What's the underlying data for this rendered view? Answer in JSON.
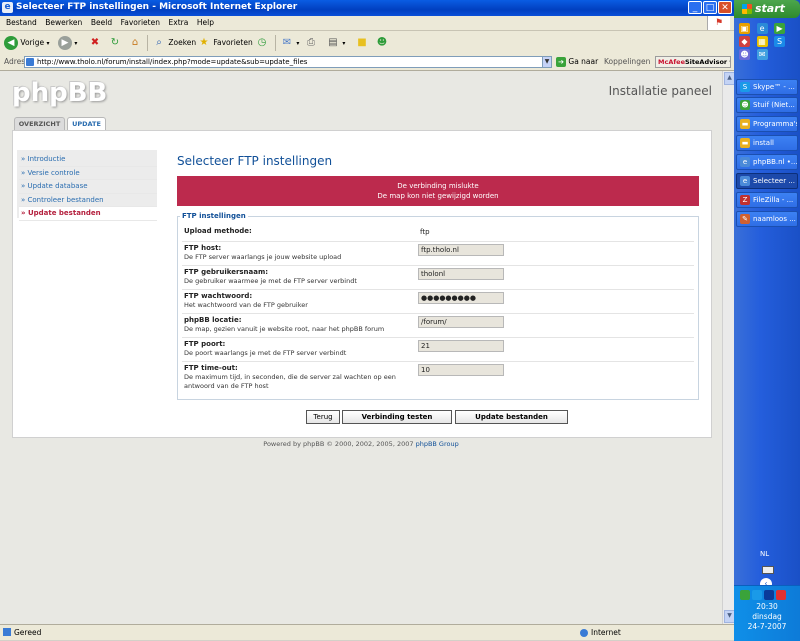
{
  "window": {
    "title": "Selecteer FTP instellingen - Microsoft Internet Explorer"
  },
  "menu": [
    "Bestand",
    "Bewerken",
    "Beeld",
    "Favorieten",
    "Extra",
    "Help"
  ],
  "toolbar": {
    "back": "Vorige",
    "search": "Zoeken",
    "favorites": "Favorieten"
  },
  "address": {
    "label": "Adres",
    "url": "http://www.tholo.nl/forum/install/index.php?mode=update&sub=update_files",
    "go": "Ga naar",
    "links": "Koppelingen",
    "mcafee_brand": "McAfee",
    "mcafee_product": "SiteAdvisor"
  },
  "page": {
    "logo": "phpBB",
    "panel_title": "Installatie paneel",
    "tabs": [
      "OVERZICHT",
      "UPDATE"
    ],
    "side_menu": [
      {
        "label": "» Introductie",
        "active": false
      },
      {
        "label": "» Versie controle",
        "active": false
      },
      {
        "label": "» Update database",
        "active": false
      },
      {
        "label": "» Controleer bestanden",
        "active": false
      },
      {
        "label": "» Update bestanden",
        "active": true
      }
    ],
    "heading": "Selecteer FTP instellingen",
    "error": {
      "line1": "De verbinding mislukte",
      "line2": "De map kon niet gewijzigd worden"
    },
    "legend": "FTP instellingen",
    "fields": {
      "method": {
        "label": "Upload methode:",
        "value": "ftp"
      },
      "host": {
        "label": "FTP host:",
        "desc": "De FTP server waarlangs je jouw website upload",
        "value": "ftp.tholo.nl"
      },
      "user": {
        "label": "FTP gebruikersnaam:",
        "desc": "De gebruiker waarmee je met de FTP server verbindt",
        "value": "tholonl"
      },
      "password": {
        "label": "FTP wachtwoord:",
        "desc": "Het wachtwoord van de FTP gebruiker",
        "value": "●●●●●●●●●"
      },
      "path": {
        "label": "phpBB locatie:",
        "desc": "De map, gezien vanuit je website root, naar het phpBB forum",
        "value": "/forum/"
      },
      "port": {
        "label": "FTP poort:",
        "desc": "De poort waarlangs je met de FTP server verbindt",
        "value": "21"
      },
      "timeout": {
        "label": "FTP time-out:",
        "desc": "De maximum tijd, in seconden, die de server zal wachten op een antwoord van de FTP host",
        "value": "10"
      }
    },
    "buttons": {
      "back": "Terug",
      "test": "Verbinding testen",
      "update": "Update bestanden"
    },
    "footer": {
      "text": "Powered by phpBB © 2000, 2002, 2005, 2007",
      "group": "phpBB Group"
    }
  },
  "status": {
    "text": "Gereed",
    "zone": "Internet"
  },
  "taskbar": {
    "start": "start",
    "tasks": [
      "Skype™ - ...",
      "Stuif (Niet...",
      "Programma's",
      "install",
      "phpBB.nl •...",
      "Selecteer ...",
      "FileZilla - ...",
      "naamloos ..."
    ],
    "language": "NL",
    "time": "20:30",
    "day": "dinsdag",
    "date": "24-7-2007"
  },
  "colors": {
    "accent": "#115098",
    "error_bg": "#bc2a4d",
    "active_menu": "#b41f3d",
    "taskbar": "#245edc"
  }
}
